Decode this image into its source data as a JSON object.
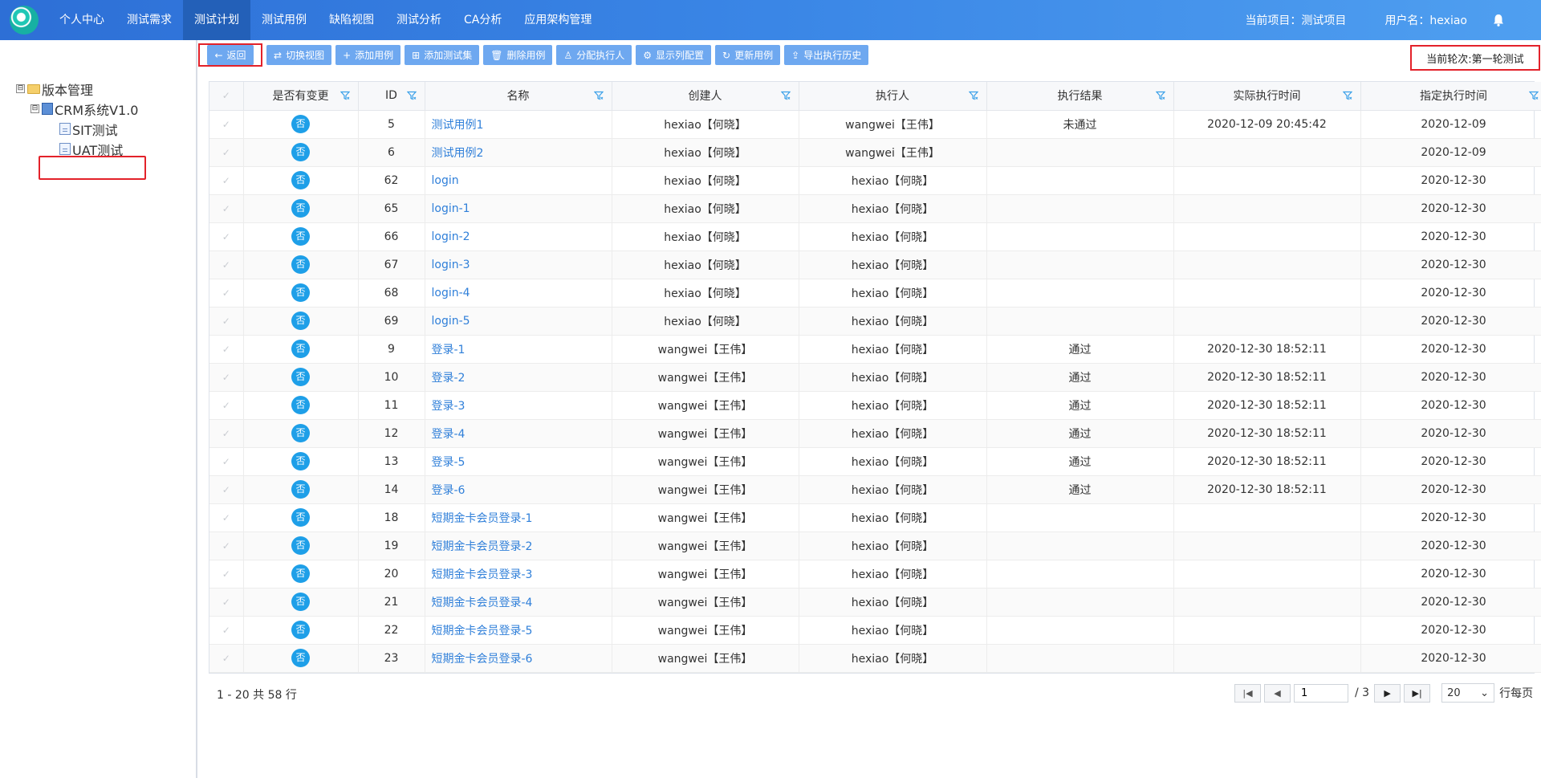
{
  "nav": {
    "items": [
      {
        "label": "个人中心",
        "active": false
      },
      {
        "label": "测试需求",
        "active": false
      },
      {
        "label": "测试计划",
        "active": true
      },
      {
        "label": "测试用例",
        "active": false
      },
      {
        "label": "缺陷视图",
        "active": false
      },
      {
        "label": "测试分析",
        "active": false
      },
      {
        "label": "CA分析",
        "active": false
      },
      {
        "label": "应用架构管理",
        "active": false
      }
    ],
    "current_project": "当前项目：测试项目",
    "username": "用户名：hexiao",
    "bell_icon": "bell-icon"
  },
  "sidebar": {
    "tree": [
      {
        "toggle": "⊟",
        "icon": "folder-icon",
        "label": "版本管理",
        "level": 0
      },
      {
        "toggle": "⊟",
        "icon": "book-icon",
        "label": "CRM系统V1.0",
        "level": 1
      },
      {
        "toggle": "",
        "icon": "page-icon",
        "label": "SIT测试",
        "level": 2,
        "selected": true
      },
      {
        "toggle": "",
        "icon": "page-icon",
        "label": "UAT测试",
        "level": 2
      }
    ]
  },
  "toolbar": {
    "buttons": [
      {
        "icon": "←",
        "label": "返回"
      },
      {
        "icon": "⇄",
        "label": "切换视图"
      },
      {
        "icon": "+",
        "label": "添加用例"
      },
      {
        "icon": "⊞",
        "label": "添加测试集"
      },
      {
        "icon": "🗑",
        "label": "删除用例"
      },
      {
        "icon": "♙",
        "label": "分配执行人"
      },
      {
        "icon": "⚙",
        "label": "显示列配置"
      },
      {
        "icon": "↻",
        "label": "更新用例"
      },
      {
        "icon": "⇪",
        "label": "导出执行历史"
      }
    ],
    "round": "当前轮次:第一轮测试"
  },
  "table": {
    "columns": [
      "是否有变更",
      "ID",
      "名称",
      "创建人",
      "执行人",
      "执行结果",
      "实际执行时间",
      "指定执行时间"
    ],
    "rows": [
      {
        "changed": "否",
        "id": "5",
        "name": "测试用例1",
        "creator": "hexiao【何晓】",
        "executor": "wangwei【王伟】",
        "result": "未通过",
        "actual": "2020-12-09 20:45:42",
        "planned": "2020-12-09"
      },
      {
        "changed": "否",
        "id": "6",
        "name": "测试用例2",
        "creator": "hexiao【何晓】",
        "executor": "wangwei【王伟】",
        "result": "",
        "actual": "",
        "planned": "2020-12-09"
      },
      {
        "changed": "否",
        "id": "62",
        "name": "login",
        "creator": "hexiao【何晓】",
        "executor": "hexiao【何晓】",
        "result": "",
        "actual": "",
        "planned": "2020-12-30"
      },
      {
        "changed": "否",
        "id": "65",
        "name": "login-1",
        "creator": "hexiao【何晓】",
        "executor": "hexiao【何晓】",
        "result": "",
        "actual": "",
        "planned": "2020-12-30"
      },
      {
        "changed": "否",
        "id": "66",
        "name": "login-2",
        "creator": "hexiao【何晓】",
        "executor": "hexiao【何晓】",
        "result": "",
        "actual": "",
        "planned": "2020-12-30"
      },
      {
        "changed": "否",
        "id": "67",
        "name": "login-3",
        "creator": "hexiao【何晓】",
        "executor": "hexiao【何晓】",
        "result": "",
        "actual": "",
        "planned": "2020-12-30"
      },
      {
        "changed": "否",
        "id": "68",
        "name": "login-4",
        "creator": "hexiao【何晓】",
        "executor": "hexiao【何晓】",
        "result": "",
        "actual": "",
        "planned": "2020-12-30"
      },
      {
        "changed": "否",
        "id": "69",
        "name": "login-5",
        "creator": "hexiao【何晓】",
        "executor": "hexiao【何晓】",
        "result": "",
        "actual": "",
        "planned": "2020-12-30"
      },
      {
        "changed": "否",
        "id": "9",
        "name": "登录-1",
        "creator": "wangwei【王伟】",
        "executor": "hexiao【何晓】",
        "result": "通过",
        "actual": "2020-12-30 18:52:11",
        "planned": "2020-12-30"
      },
      {
        "changed": "否",
        "id": "10",
        "name": "登录-2",
        "creator": "wangwei【王伟】",
        "executor": "hexiao【何晓】",
        "result": "通过",
        "actual": "2020-12-30 18:52:11",
        "planned": "2020-12-30"
      },
      {
        "changed": "否",
        "id": "11",
        "name": "登录-3",
        "creator": "wangwei【王伟】",
        "executor": "hexiao【何晓】",
        "result": "通过",
        "actual": "2020-12-30 18:52:11",
        "planned": "2020-12-30"
      },
      {
        "changed": "否",
        "id": "12",
        "name": "登录-4",
        "creator": "wangwei【王伟】",
        "executor": "hexiao【何晓】",
        "result": "通过",
        "actual": "2020-12-30 18:52:11",
        "planned": "2020-12-30"
      },
      {
        "changed": "否",
        "id": "13",
        "name": "登录-5",
        "creator": "wangwei【王伟】",
        "executor": "hexiao【何晓】",
        "result": "通过",
        "actual": "2020-12-30 18:52:11",
        "planned": "2020-12-30"
      },
      {
        "changed": "否",
        "id": "14",
        "name": "登录-6",
        "creator": "wangwei【王伟】",
        "executor": "hexiao【何晓】",
        "result": "通过",
        "actual": "2020-12-30 18:52:11",
        "planned": "2020-12-30"
      },
      {
        "changed": "否",
        "id": "18",
        "name": "短期金卡会员登录-1",
        "creator": "wangwei【王伟】",
        "executor": "hexiao【何晓】",
        "result": "",
        "actual": "",
        "planned": "2020-12-30"
      },
      {
        "changed": "否",
        "id": "19",
        "name": "短期金卡会员登录-2",
        "creator": "wangwei【王伟】",
        "executor": "hexiao【何晓】",
        "result": "",
        "actual": "",
        "planned": "2020-12-30"
      },
      {
        "changed": "否",
        "id": "20",
        "name": "短期金卡会员登录-3",
        "creator": "wangwei【王伟】",
        "executor": "hexiao【何晓】",
        "result": "",
        "actual": "",
        "planned": "2020-12-30"
      },
      {
        "changed": "否",
        "id": "21",
        "name": "短期金卡会员登录-4",
        "creator": "wangwei【王伟】",
        "executor": "hexiao【何晓】",
        "result": "",
        "actual": "",
        "planned": "2020-12-30"
      },
      {
        "changed": "否",
        "id": "22",
        "name": "短期金卡会员登录-5",
        "creator": "wangwei【王伟】",
        "executor": "hexiao【何晓】",
        "result": "",
        "actual": "",
        "planned": "2020-12-30"
      },
      {
        "changed": "否",
        "id": "23",
        "name": "短期金卡会员登录-6",
        "creator": "wangwei【王伟】",
        "executor": "hexiao【何晓】",
        "result": "",
        "actual": "",
        "planned": "2020-12-30"
      }
    ]
  },
  "pager": {
    "info": "1 - 20 共 58 行",
    "current_page": "1",
    "total_pages": "/ 3",
    "page_size": "20",
    "per_page_label": "行每页"
  },
  "colors": {
    "nav_bg": "#3a86e6",
    "nav_active": "#2360b8",
    "button": "#6ea8f0",
    "link": "#2f7fd9",
    "badge": "#1e9fe8",
    "highlight": "#e3222a"
  }
}
